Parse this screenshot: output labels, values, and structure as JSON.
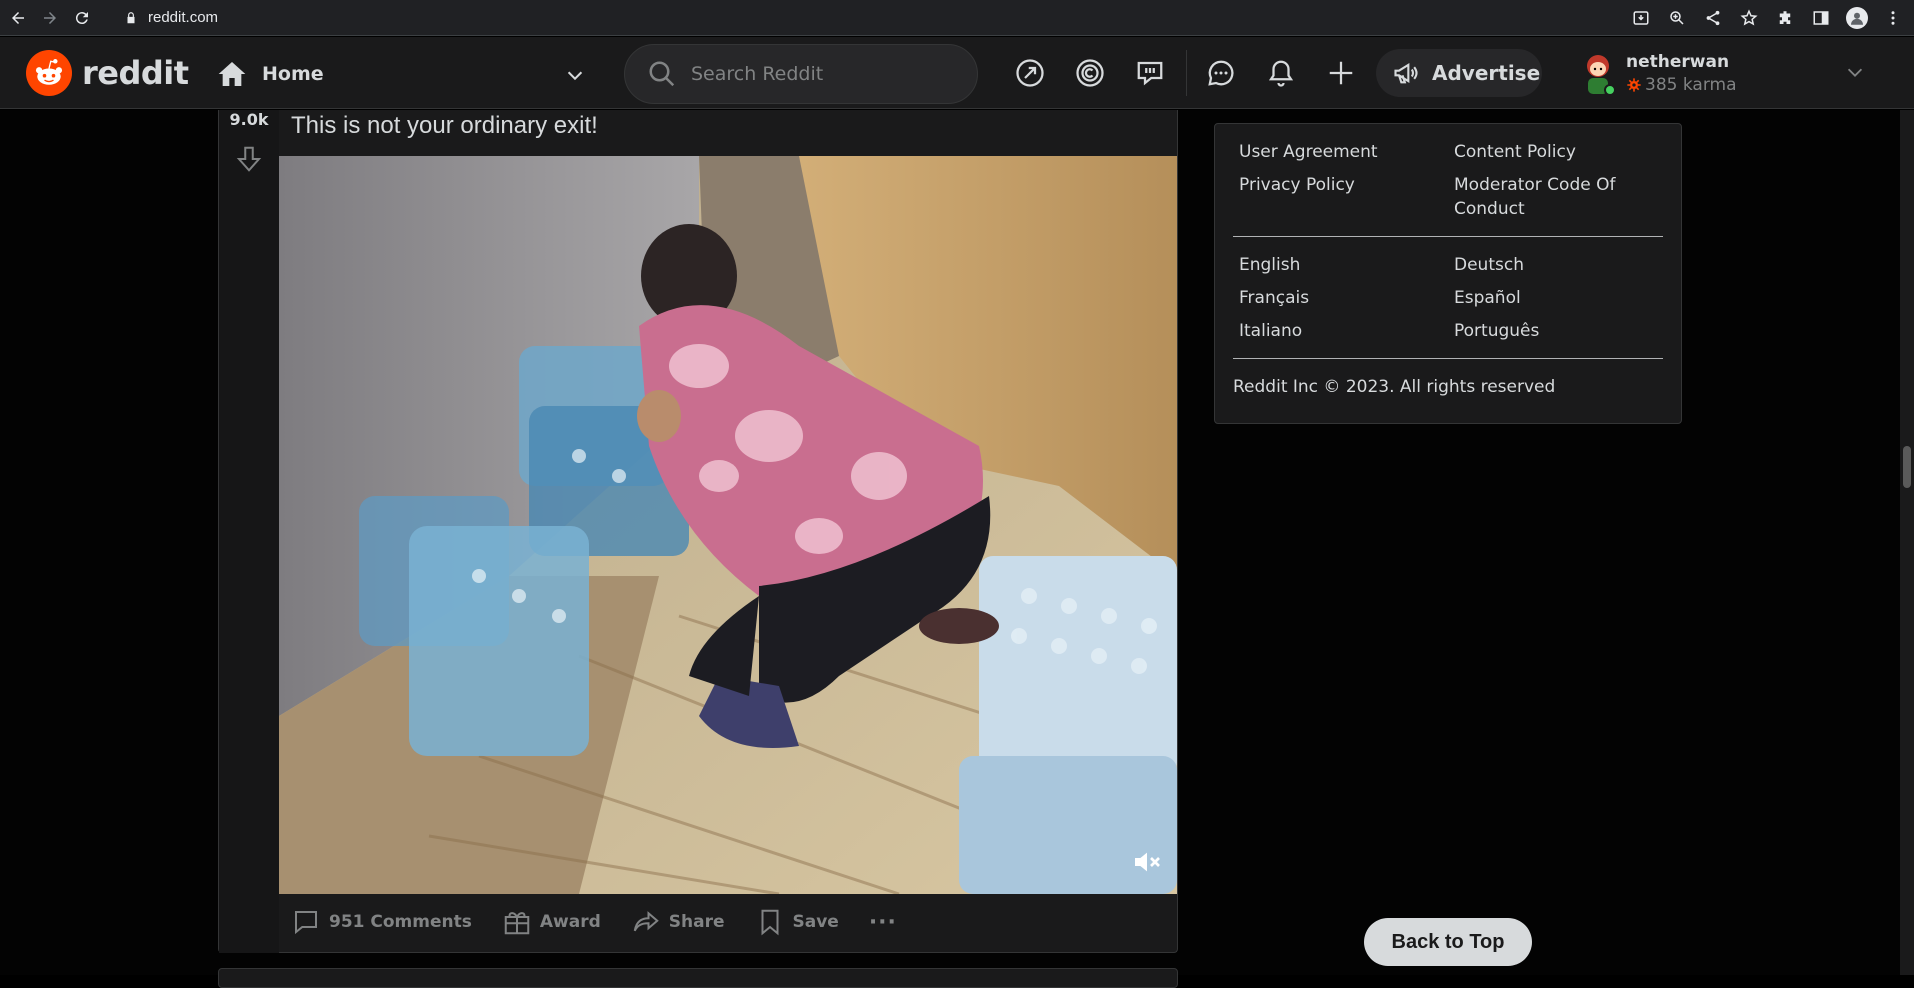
{
  "browser": {
    "url": "reddit.com",
    "icons": [
      "back-icon",
      "forward-icon",
      "reload-icon",
      "lock-icon",
      "install-icon",
      "zoom-icon",
      "share-icon",
      "star-icon",
      "extensions-icon",
      "sidepanel-icon",
      "profile-icon",
      "menu-icon"
    ]
  },
  "header": {
    "logo_text": "reddit",
    "feed_label": "Home",
    "search_placeholder": "Search Reddit",
    "advertise_label": "Advertise",
    "username": "netherwan",
    "karma": "385 karma",
    "brand_color": "#ff4500"
  },
  "post": {
    "vote_count": "9.0k",
    "title": "This is not your ordinary exit!",
    "comments_label": "951 Comments",
    "award_label": "Award",
    "share_label": "Share",
    "save_label": "Save",
    "more_label": "···"
  },
  "sidebar": {
    "links_col": [
      [
        "User Agreement",
        "Content Policy"
      ],
      [
        "Privacy Policy",
        "Moderator Code Of Conduct"
      ]
    ],
    "languages": [
      [
        "English",
        "Deutsch"
      ],
      [
        "Français",
        "Español"
      ],
      [
        "Italiano",
        "Português"
      ]
    ],
    "copyright": "Reddit Inc © 2023. All rights reserved"
  },
  "back_to_top": "Back to Top"
}
